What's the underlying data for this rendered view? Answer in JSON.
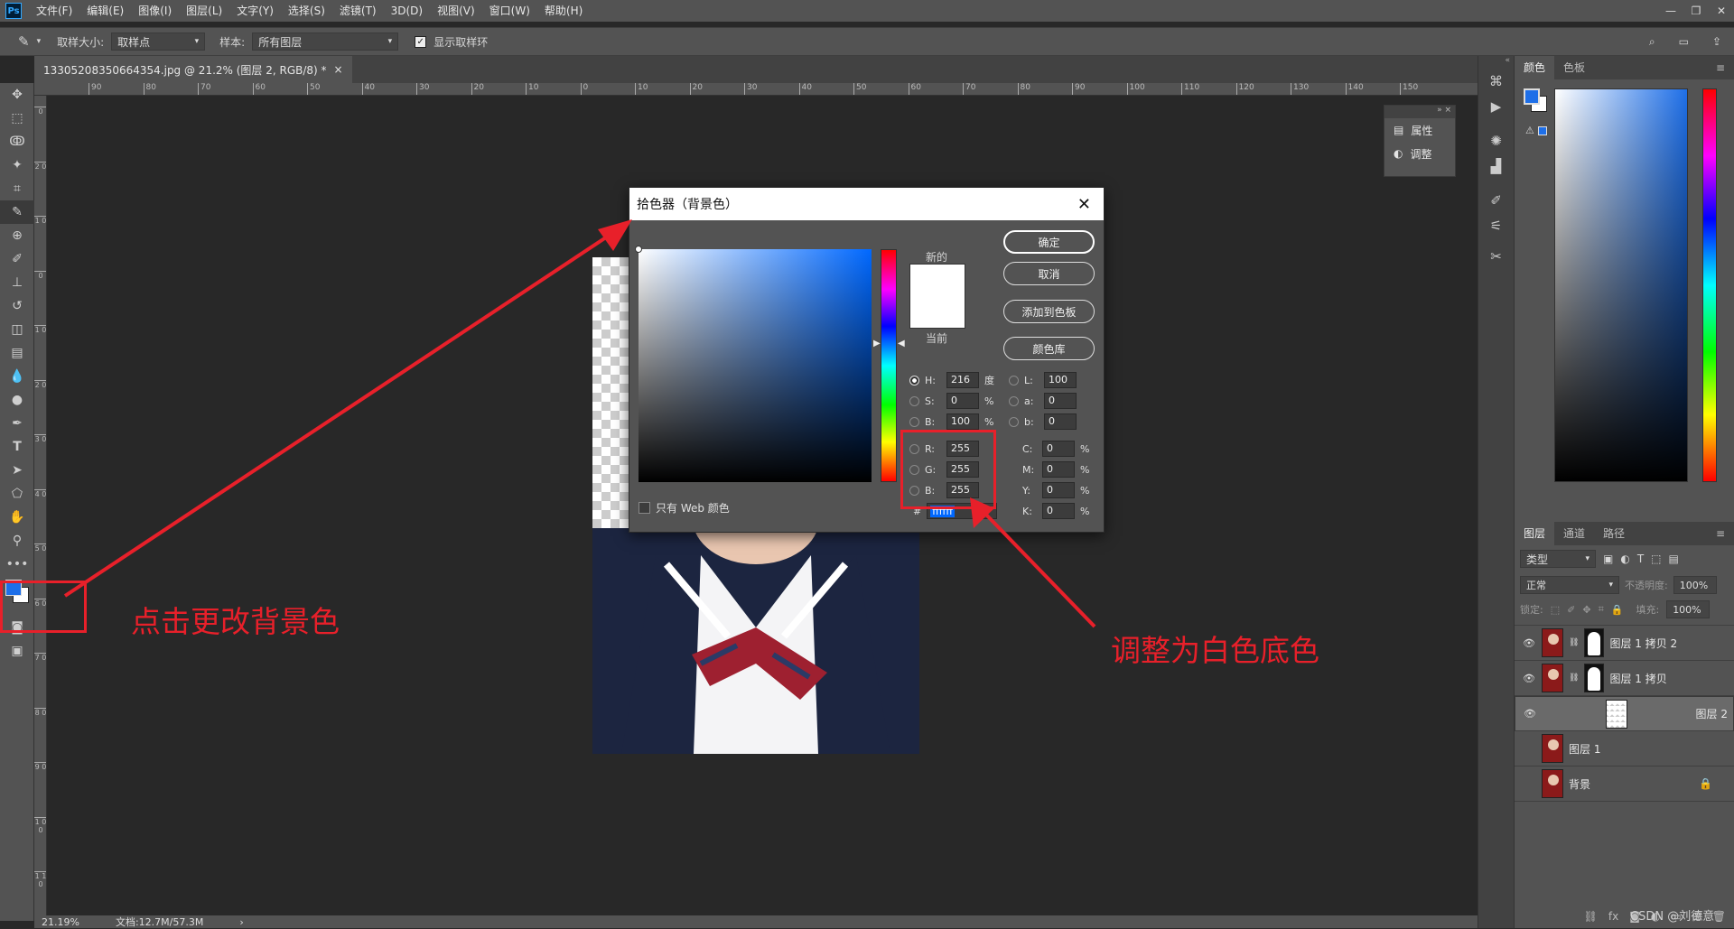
{
  "app": {
    "logo": "Ps"
  },
  "menubar": {
    "items": [
      "文件(F)",
      "编辑(E)",
      "图像(I)",
      "图层(L)",
      "文字(Y)",
      "选择(S)",
      "滤镜(T)",
      "3D(D)",
      "视图(V)",
      "窗口(W)",
      "帮助(H)"
    ]
  },
  "options": {
    "sample_size_label": "取样大小:",
    "sample_size_value": "取样点",
    "sample_label": "样本:",
    "sample_value": "所有图层",
    "show_ring_label": "显示取样环"
  },
  "document": {
    "tab_title": "13305208350664354.jpg @ 21.2% (图层 2, RGB/8) *"
  },
  "ruler": {
    "top": [
      "90",
      "80",
      "70",
      "60",
      "50",
      "40",
      "30",
      "20",
      "10",
      "0",
      "10",
      "20",
      "30",
      "40",
      "50",
      "60",
      "70",
      "80",
      "90",
      "100",
      "110",
      "120",
      "130",
      "140",
      "150"
    ],
    "left": [
      "0",
      "2 0",
      "1 0",
      "0",
      "1 0",
      "2 0",
      "3 0",
      "4 0",
      "5 0",
      "6 0",
      "7 0",
      "8 0",
      "9 0",
      "1 0 0",
      "1 1 0"
    ]
  },
  "status": {
    "zoom": "21.19%",
    "doc_size": "文档:12.7M/57.3M"
  },
  "mini_panel": {
    "items": [
      "属性",
      "调整"
    ]
  },
  "color_panel": {
    "tabs": [
      "颜色",
      "色板"
    ],
    "fg_color": "#1e6fe8",
    "bg_color": "#ffffff"
  },
  "layers_panel": {
    "tabs": [
      "图层",
      "通道",
      "路径"
    ],
    "kind": "类型",
    "blend": "正常",
    "opacity_label": "不透明度:",
    "opacity_value": "100%",
    "lock_label": "锁定:",
    "fill_label": "填充:",
    "fill_value": "100%",
    "layers": [
      {
        "name": "图层 1 拷贝 2",
        "visible": true,
        "mask": true
      },
      {
        "name": "图层 1 拷贝",
        "visible": true,
        "mask": true
      },
      {
        "name": "图层 2",
        "visible": true,
        "selected": true
      },
      {
        "name": "图层 1",
        "visible": false
      },
      {
        "name": "背景",
        "visible": false,
        "locked": true
      }
    ]
  },
  "dialog": {
    "title": "拾色器（背景色）",
    "new_label": "新的",
    "current_label": "当前",
    "buttons": {
      "ok": "确定",
      "cancel": "取消",
      "add_swatch": "添加到色板",
      "library": "颜色库"
    },
    "web_only": "只有 Web 颜色",
    "fields": {
      "H": {
        "label": "H:",
        "value": "216",
        "unit": "度"
      },
      "S": {
        "label": "S:",
        "value": "0",
        "unit": "%"
      },
      "B": {
        "label": "B:",
        "value": "100",
        "unit": "%"
      },
      "R": {
        "label": "R:",
        "value": "255"
      },
      "G": {
        "label": "G:",
        "value": "255"
      },
      "Bl": {
        "label": "B:",
        "value": "255"
      },
      "L": {
        "label": "L:",
        "value": "100"
      },
      "a": {
        "label": "a:",
        "value": "0"
      },
      "b": {
        "label": "b:",
        "value": "0"
      },
      "C": {
        "label": "C:",
        "value": "0",
        "unit": "%"
      },
      "M": {
        "label": "M:",
        "value": "0",
        "unit": "%"
      },
      "Y": {
        "label": "Y:",
        "value": "0",
        "unit": "%"
      },
      "K": {
        "label": "K:",
        "value": "0",
        "unit": "%"
      }
    },
    "hex_label": "#",
    "hex_value": "ffffff",
    "accent": "#0068ff"
  },
  "annotations": {
    "left": "点击更改背景色",
    "right": "调整为白色底色",
    "color": "#e8202a"
  },
  "watermark": "CSDN @刘德意"
}
